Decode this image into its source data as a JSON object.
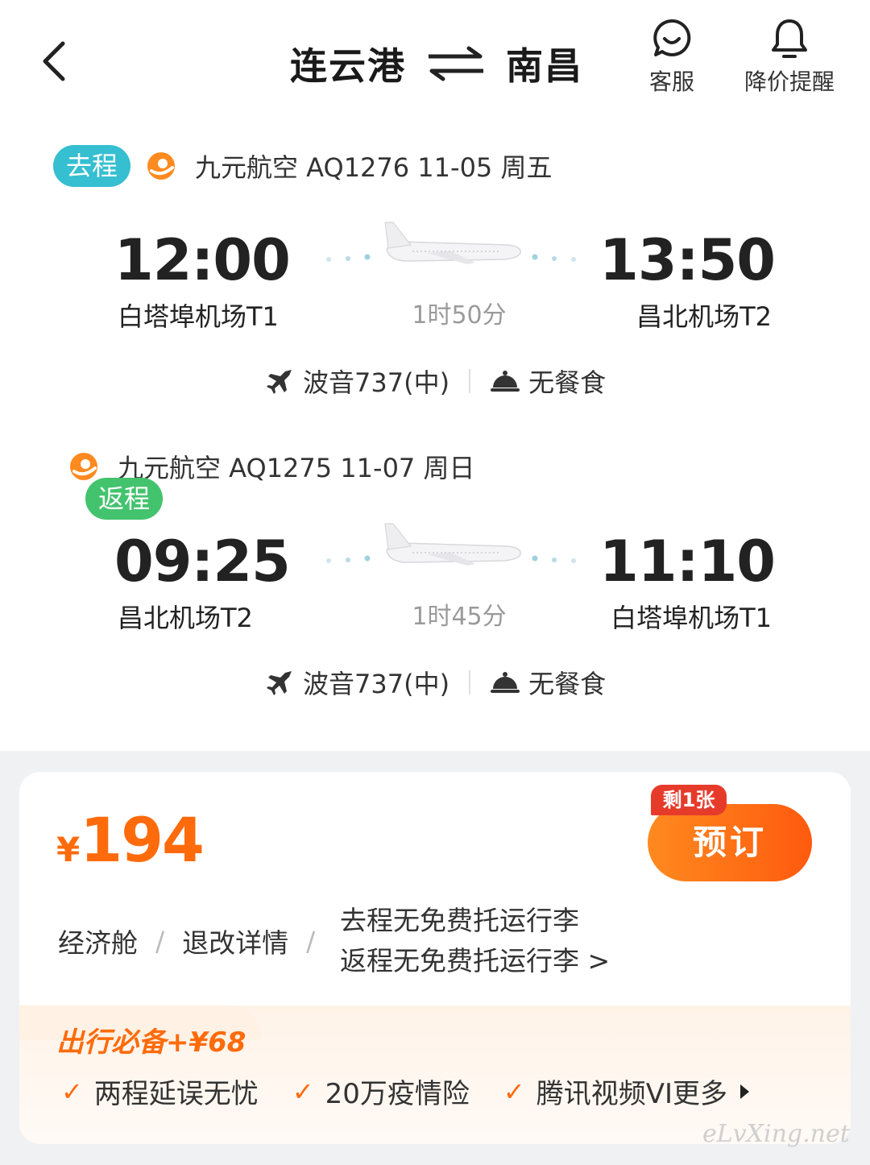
{
  "header": {
    "from_city": "连云港",
    "to_city": "南昌",
    "service_label": "客服",
    "alert_label": "降价提醒"
  },
  "outbound": {
    "tag": "去程",
    "info": "九元航空 AQ1276  11-05 周五",
    "dep_time": "12:00",
    "dep_airport": "白塔埠机场T1",
    "arr_time": "13:50",
    "arr_airport": "昌北机场T2",
    "duration": "1时50分",
    "aircraft": "波音737(中)",
    "meal": "无餐食"
  },
  "return": {
    "tag": "返程",
    "info": "九元航空 AQ1275  11-07 周日",
    "dep_time": "09:25",
    "dep_airport": "昌北机场T2",
    "arr_time": "11:10",
    "arr_airport": "白塔埠机场T1",
    "duration": "1时45分",
    "aircraft": "波音737(中)",
    "meal": "无餐食"
  },
  "fare": {
    "currency": "¥",
    "price": "194",
    "remaining_badge": "剩1张",
    "book_label": "预订",
    "cabin": "经济舱",
    "refund_label": "退改详情",
    "baggage_out": "去程无免费托运行李",
    "baggage_back": "返程无免费托运行李 >",
    "separator": "/"
  },
  "addon": {
    "title": "出行必备+¥68",
    "items": [
      "两程延误无忧",
      "20万疫情险",
      "腾讯视频VI"
    ],
    "more_label": "更多"
  },
  "watermark": "eLvXing.net",
  "colors": {
    "accent": "#ff6b0b",
    "go_tag": "#35bfd1",
    "back_tag": "#43c36e",
    "badge_red": "#e63b2b"
  }
}
